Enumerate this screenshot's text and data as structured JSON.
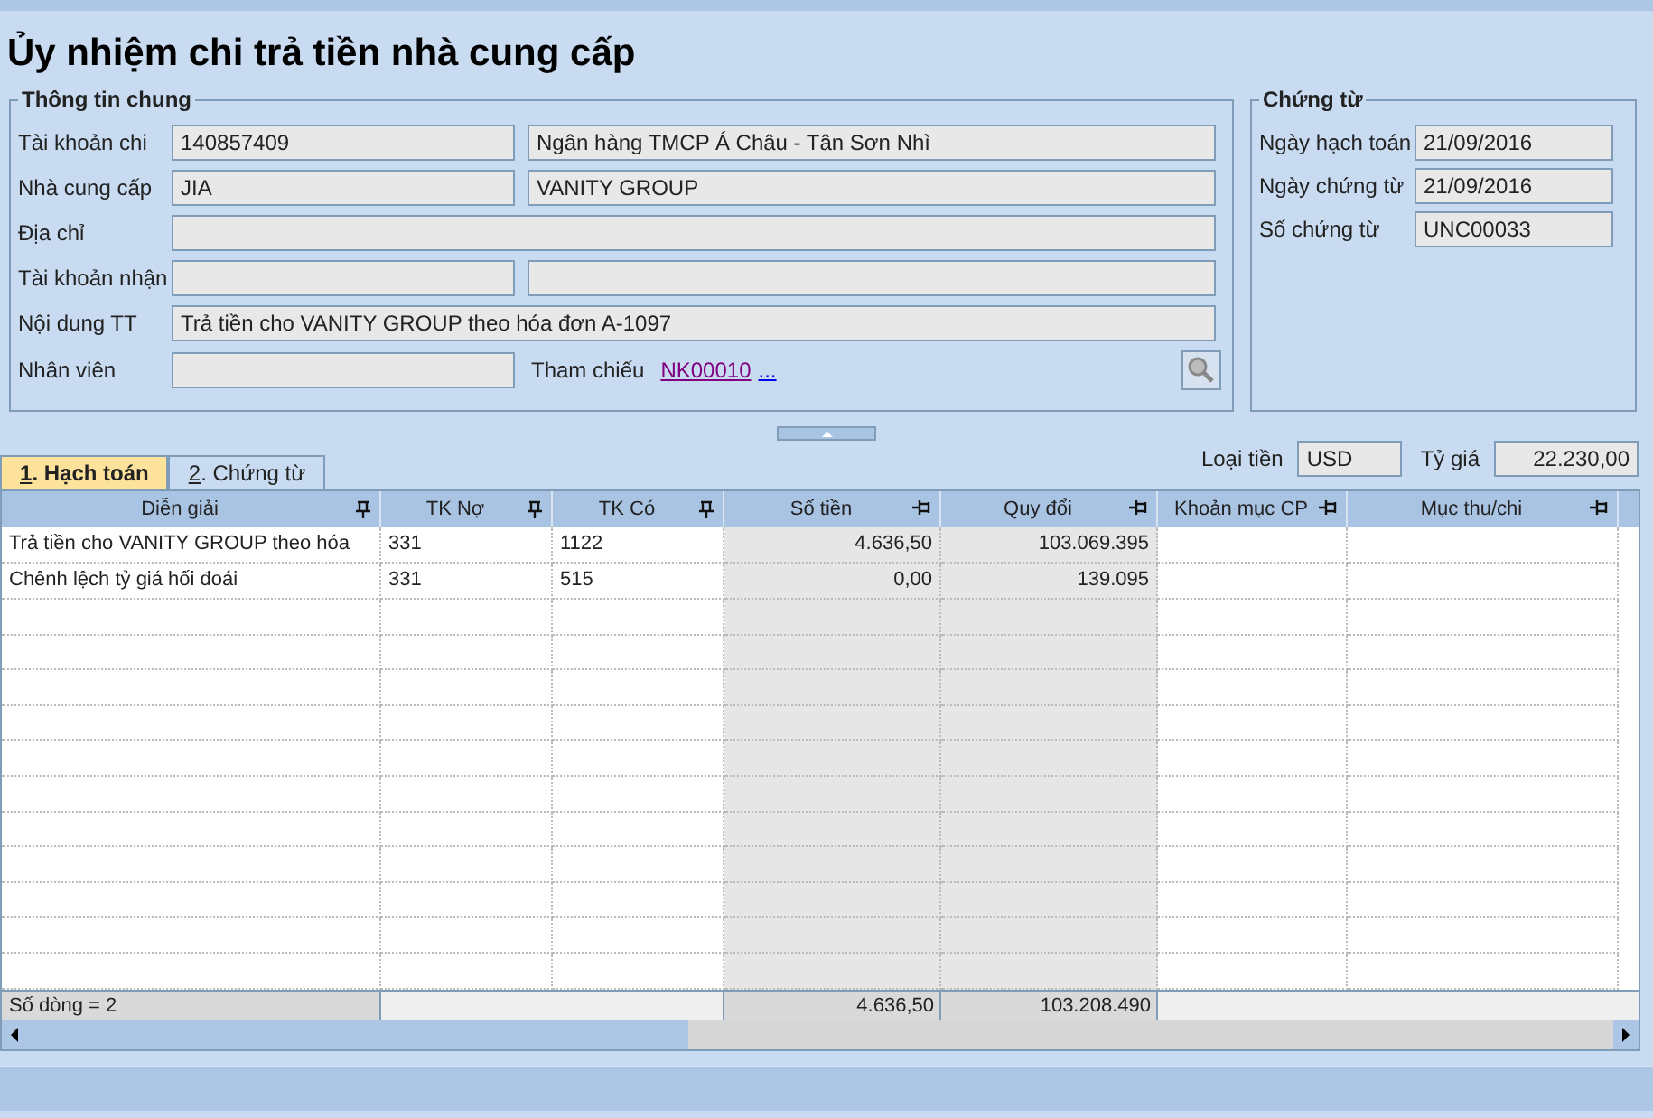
{
  "title": "Ủy nhiệm chi trả tiền nhà cung cấp",
  "general": {
    "title": "Thông tin chung",
    "rows": [
      {
        "label": "Tài khoản chi",
        "fields": [
          "140857409",
          "Ngân hàng TMCP Á Châu - Tân Sơn Nhì"
        ],
        "kind": "pair"
      },
      {
        "label": "Nhà cung cấp",
        "fields": [
          "JIA",
          "VANITY GROUP"
        ],
        "kind": "pair"
      },
      {
        "label": "Địa chỉ",
        "kind": "wide"
      },
      {
        "label": "Tài khoản nhận",
        "kind": "pair"
      },
      {
        "label": "Nội dung TT",
        "fields": [
          "Trả tiền cho VANITY GROUP theo hóa đơn A-1097"
        ],
        "kind": "wide"
      }
    ],
    "employee": {
      "label": "Nhân viên"
    },
    "reference": {
      "label": "Tham chiếu",
      "link": "NK00010",
      "more": "..."
    }
  },
  "voucher": {
    "title": "Chứng từ",
    "rows": [
      {
        "label": "Ngày hạch toán",
        "value": "21/09/2016"
      },
      {
        "label": "Ngày chứng từ",
        "value": "21/09/2016"
      },
      {
        "label": "Số chứng từ",
        "value": "UNC00033"
      }
    ]
  },
  "tabs": [
    {
      "label": "1. Hạch toán",
      "selected": true
    },
    {
      "label": "2. Chứng từ",
      "selected": false
    }
  ],
  "currency": {
    "label": "Loại tiền",
    "value": "USD"
  },
  "rate": {
    "label": "Tỷ giá",
    "value": "22.230,00"
  },
  "table": {
    "columns": [
      {
        "label": "Diễn giải",
        "pinned": true,
        "shaded": false,
        "kind": "text"
      },
      {
        "label": "TK Nợ",
        "pinned": true,
        "shaded": false,
        "kind": "text"
      },
      {
        "label": "TK Có",
        "pinned": true,
        "shaded": false,
        "kind": "text"
      },
      {
        "label": "Số tiền",
        "pinned": false,
        "shaded": true,
        "kind": "number"
      },
      {
        "label": "Quy đổi",
        "pinned": false,
        "shaded": true,
        "kind": "number"
      },
      {
        "label": "Khoản mục CP",
        "pinned": false,
        "shaded": false,
        "kind": "text"
      },
      {
        "label": "Mục thu/chi",
        "pinned": false,
        "shaded": false,
        "kind": "text"
      }
    ],
    "rows": [
      [
        "Trả tiền cho VANITY GROUP theo hóa",
        "331",
        "1122",
        "4.636,50",
        "103.069.395",
        "",
        ""
      ],
      [
        "Chênh lệch tỷ giá hối đoái",
        "331",
        "515",
        "0,00",
        "139.095",
        "",
        ""
      ]
    ],
    "footer": {
      "count": "Số dòng = 2",
      "totals": [
        "4.636,50",
        "103.208.490"
      ]
    }
  }
}
